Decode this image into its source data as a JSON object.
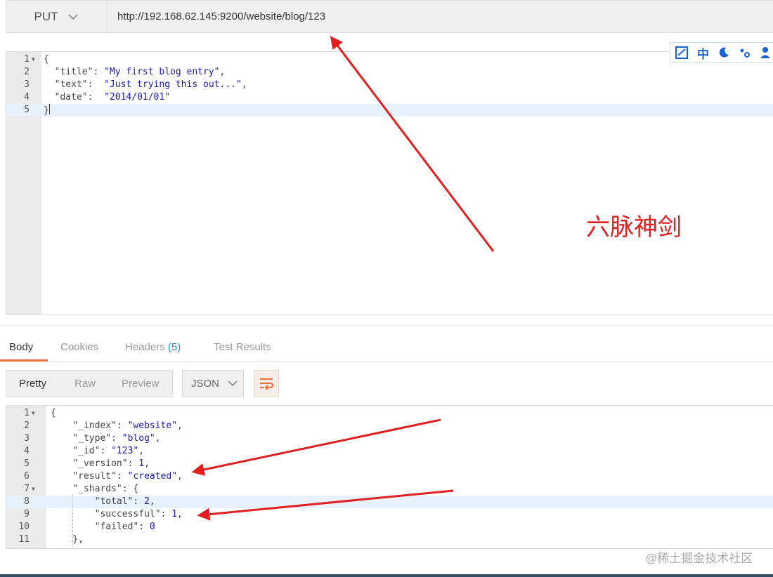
{
  "request": {
    "method": "PUT",
    "url": "http://192.168.62.145:9200/website/blog/123"
  },
  "request_body": [
    {
      "n": "1",
      "fold": true,
      "tokens": [
        [
          "p",
          "{"
        ]
      ]
    },
    {
      "n": "2",
      "tokens": [
        [
          "p",
          "  "
        ],
        [
          "k",
          "\"title\""
        ],
        [
          "p",
          ": "
        ],
        [
          "s",
          "\"My first blog entry\""
        ],
        [
          "p",
          ","
        ]
      ]
    },
    {
      "n": "3",
      "tokens": [
        [
          "p",
          "  "
        ],
        [
          "k",
          "\"text\""
        ],
        [
          "p",
          ":  "
        ],
        [
          "s",
          "\"Just trying this out...\""
        ],
        [
          "p",
          ","
        ]
      ]
    },
    {
      "n": "4",
      "tokens": [
        [
          "p",
          "  "
        ],
        [
          "k",
          "\"date\""
        ],
        [
          "p",
          ":  "
        ],
        [
          "s",
          "\"2014/01/01\""
        ]
      ]
    },
    {
      "n": "5",
      "active": true,
      "tokens": [
        [
          "p",
          "}"
        ]
      ]
    }
  ],
  "ime": {
    "mode": "中",
    "icons": [
      "ime-checkbox-icon",
      "ime-chinese-mode",
      "ime-moon-icon",
      "ime-punctuation-icon",
      "ime-user-icon"
    ]
  },
  "annotation": "六脉神剑",
  "response_tabs": [
    {
      "label": "Body",
      "active": true
    },
    {
      "label": "Cookies"
    },
    {
      "label": "Headers",
      "badge": "(5)"
    },
    {
      "label": "Test Results"
    }
  ],
  "view_modes": [
    "Pretty",
    "Raw",
    "Preview"
  ],
  "format": "JSON",
  "response_body": [
    {
      "n": "1",
      "fold": true,
      "tokens": [
        [
          "p",
          "{"
        ]
      ]
    },
    {
      "n": "2",
      "tokens": [
        [
          "p",
          "    "
        ],
        [
          "k",
          "\"_index\""
        ],
        [
          "p",
          ": "
        ],
        [
          "s",
          "\"website\""
        ],
        [
          "p",
          ","
        ]
      ]
    },
    {
      "n": "3",
      "tokens": [
        [
          "p",
          "    "
        ],
        [
          "k",
          "\"_type\""
        ],
        [
          "p",
          ": "
        ],
        [
          "s",
          "\"blog\""
        ],
        [
          "p",
          ","
        ]
      ]
    },
    {
      "n": "4",
      "tokens": [
        [
          "p",
          "    "
        ],
        [
          "k",
          "\"_id\""
        ],
        [
          "p",
          ": "
        ],
        [
          "s",
          "\"123\""
        ],
        [
          "p",
          ","
        ]
      ]
    },
    {
      "n": "5",
      "tokens": [
        [
          "p",
          "    "
        ],
        [
          "k",
          "\"_version\""
        ],
        [
          "p",
          ": "
        ],
        [
          "n",
          "1"
        ],
        [
          "p",
          ","
        ]
      ]
    },
    {
      "n": "6",
      "tokens": [
        [
          "p",
          "    "
        ],
        [
          "k",
          "\"result\""
        ],
        [
          "p",
          ": "
        ],
        [
          "s",
          "\"created\""
        ],
        [
          "p",
          ","
        ]
      ]
    },
    {
      "n": "7",
      "fold": true,
      "tokens": [
        [
          "p",
          "    "
        ],
        [
          "k",
          "\"_shards\""
        ],
        [
          "p",
          ": {"
        ]
      ]
    },
    {
      "n": "8",
      "active": true,
      "tokens": [
        [
          "p",
          "        "
        ],
        [
          "k",
          "\"total\""
        ],
        [
          "p",
          ": "
        ],
        [
          "n",
          "2"
        ],
        [
          "p",
          ","
        ]
      ]
    },
    {
      "n": "9",
      "tokens": [
        [
          "p",
          "        "
        ],
        [
          "k",
          "\"successful\""
        ],
        [
          "p",
          ": "
        ],
        [
          "n",
          "1"
        ],
        [
          "p",
          ","
        ]
      ]
    },
    {
      "n": "10",
      "tokens": [
        [
          "p",
          "        "
        ],
        [
          "k",
          "\"failed\""
        ],
        [
          "p",
          ": "
        ],
        [
          "n",
          "0"
        ]
      ]
    },
    {
      "n": "11",
      "tokens": [
        [
          "p",
          "    },"
        ]
      ]
    }
  ],
  "watermark": "@稀土掘金技术社区",
  "colors": {
    "accent": "#f26b3a",
    "arrow": "#e02020",
    "badge": "#2d8fc7"
  }
}
